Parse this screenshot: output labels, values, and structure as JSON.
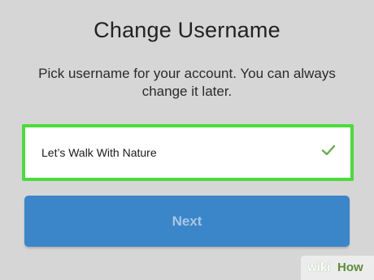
{
  "screen": {
    "title": "Change Username",
    "subtitle": "Pick username for your account. You can always change it later."
  },
  "username_field": {
    "value": "Let’s Walk With Nature",
    "status_icon": "checkmark-icon",
    "highlight_color": "#4bdc3a",
    "check_color": "#6aaa4a"
  },
  "next_button": {
    "label": "Next",
    "color": "#3b86c8"
  },
  "watermark": {
    "brand_part1": "wiki",
    "brand_part2": "How"
  }
}
